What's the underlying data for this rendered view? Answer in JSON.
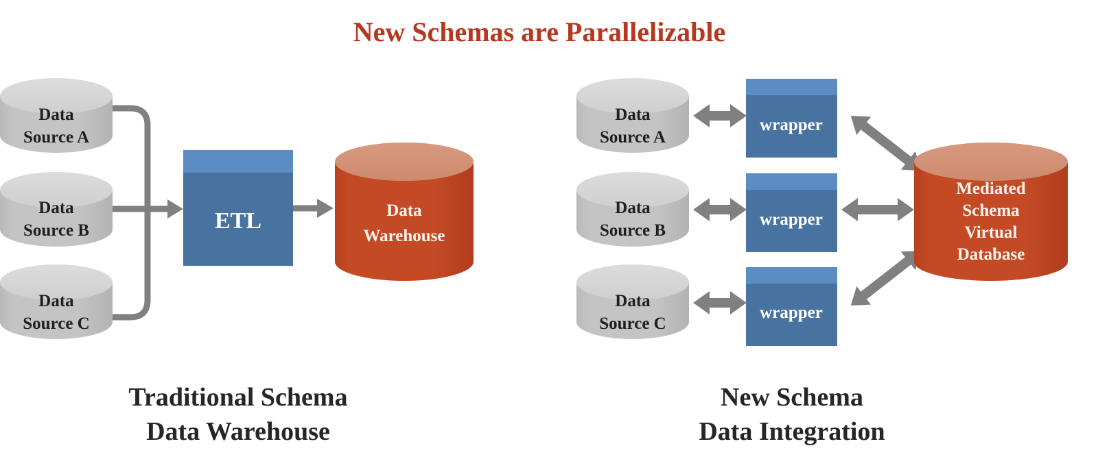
{
  "page": {
    "title": "New Schemas are Parallelizable",
    "background": "#ffffff"
  },
  "colors": {
    "title_red": "#b5381f",
    "cylinder_gray_body": "#c2c2c2",
    "cylinder_gray_top": "#d6d6d6",
    "box_blue_body": "#4872a0",
    "box_blue_top": "#5b8dc4",
    "cylinder_red_body": "#c04522",
    "cylinder_red_top": "#d28f74",
    "arrow_gray": "#808080",
    "caption_dark": "#262626",
    "text_white": "#ffffff"
  },
  "left_panel": {
    "caption_line1": "Traditional Schema",
    "caption_line2": "Data Warehouse",
    "sources": [
      {
        "line1": "Data",
        "line2": "Source A"
      },
      {
        "line1": "Data",
        "line2": "Source B"
      },
      {
        "line1": "Data",
        "line2": "Source C"
      }
    ],
    "process_box": {
      "label": "ETL"
    },
    "target": {
      "line1": "Data",
      "line2": "Warehouse"
    }
  },
  "right_panel": {
    "caption_line1": "New Schema",
    "caption_line2": "Data Integration",
    "sources": [
      {
        "line1": "Data",
        "line2": "Source A"
      },
      {
        "line1": "Data",
        "line2": "Source B"
      },
      {
        "line1": "Data",
        "line2": "Source C"
      }
    ],
    "wrappers": [
      {
        "label": "wrapper"
      },
      {
        "label": "wrapper"
      },
      {
        "label": "wrapper"
      }
    ],
    "target": {
      "line1": "Mediated",
      "line2": "Schema",
      "line3": "Virtual",
      "line4": "Database"
    }
  }
}
